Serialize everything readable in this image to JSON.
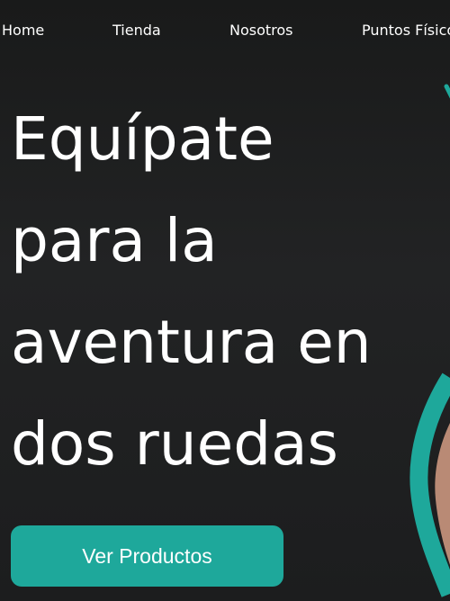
{
  "nav": {
    "items": [
      {
        "label": "Home"
      },
      {
        "label": "Tienda"
      },
      {
        "label": "Nosotros"
      },
      {
        "label": "Puntos Físicos"
      }
    ]
  },
  "hero": {
    "title_lines": [
      "Equípate",
      "para la",
      "aventura en",
      "dos ruedas"
    ],
    "cta_label": "Ver Productos"
  },
  "colors": {
    "background": "#1e1f20",
    "accent": "#1ea89b",
    "text": "#ffffff"
  }
}
